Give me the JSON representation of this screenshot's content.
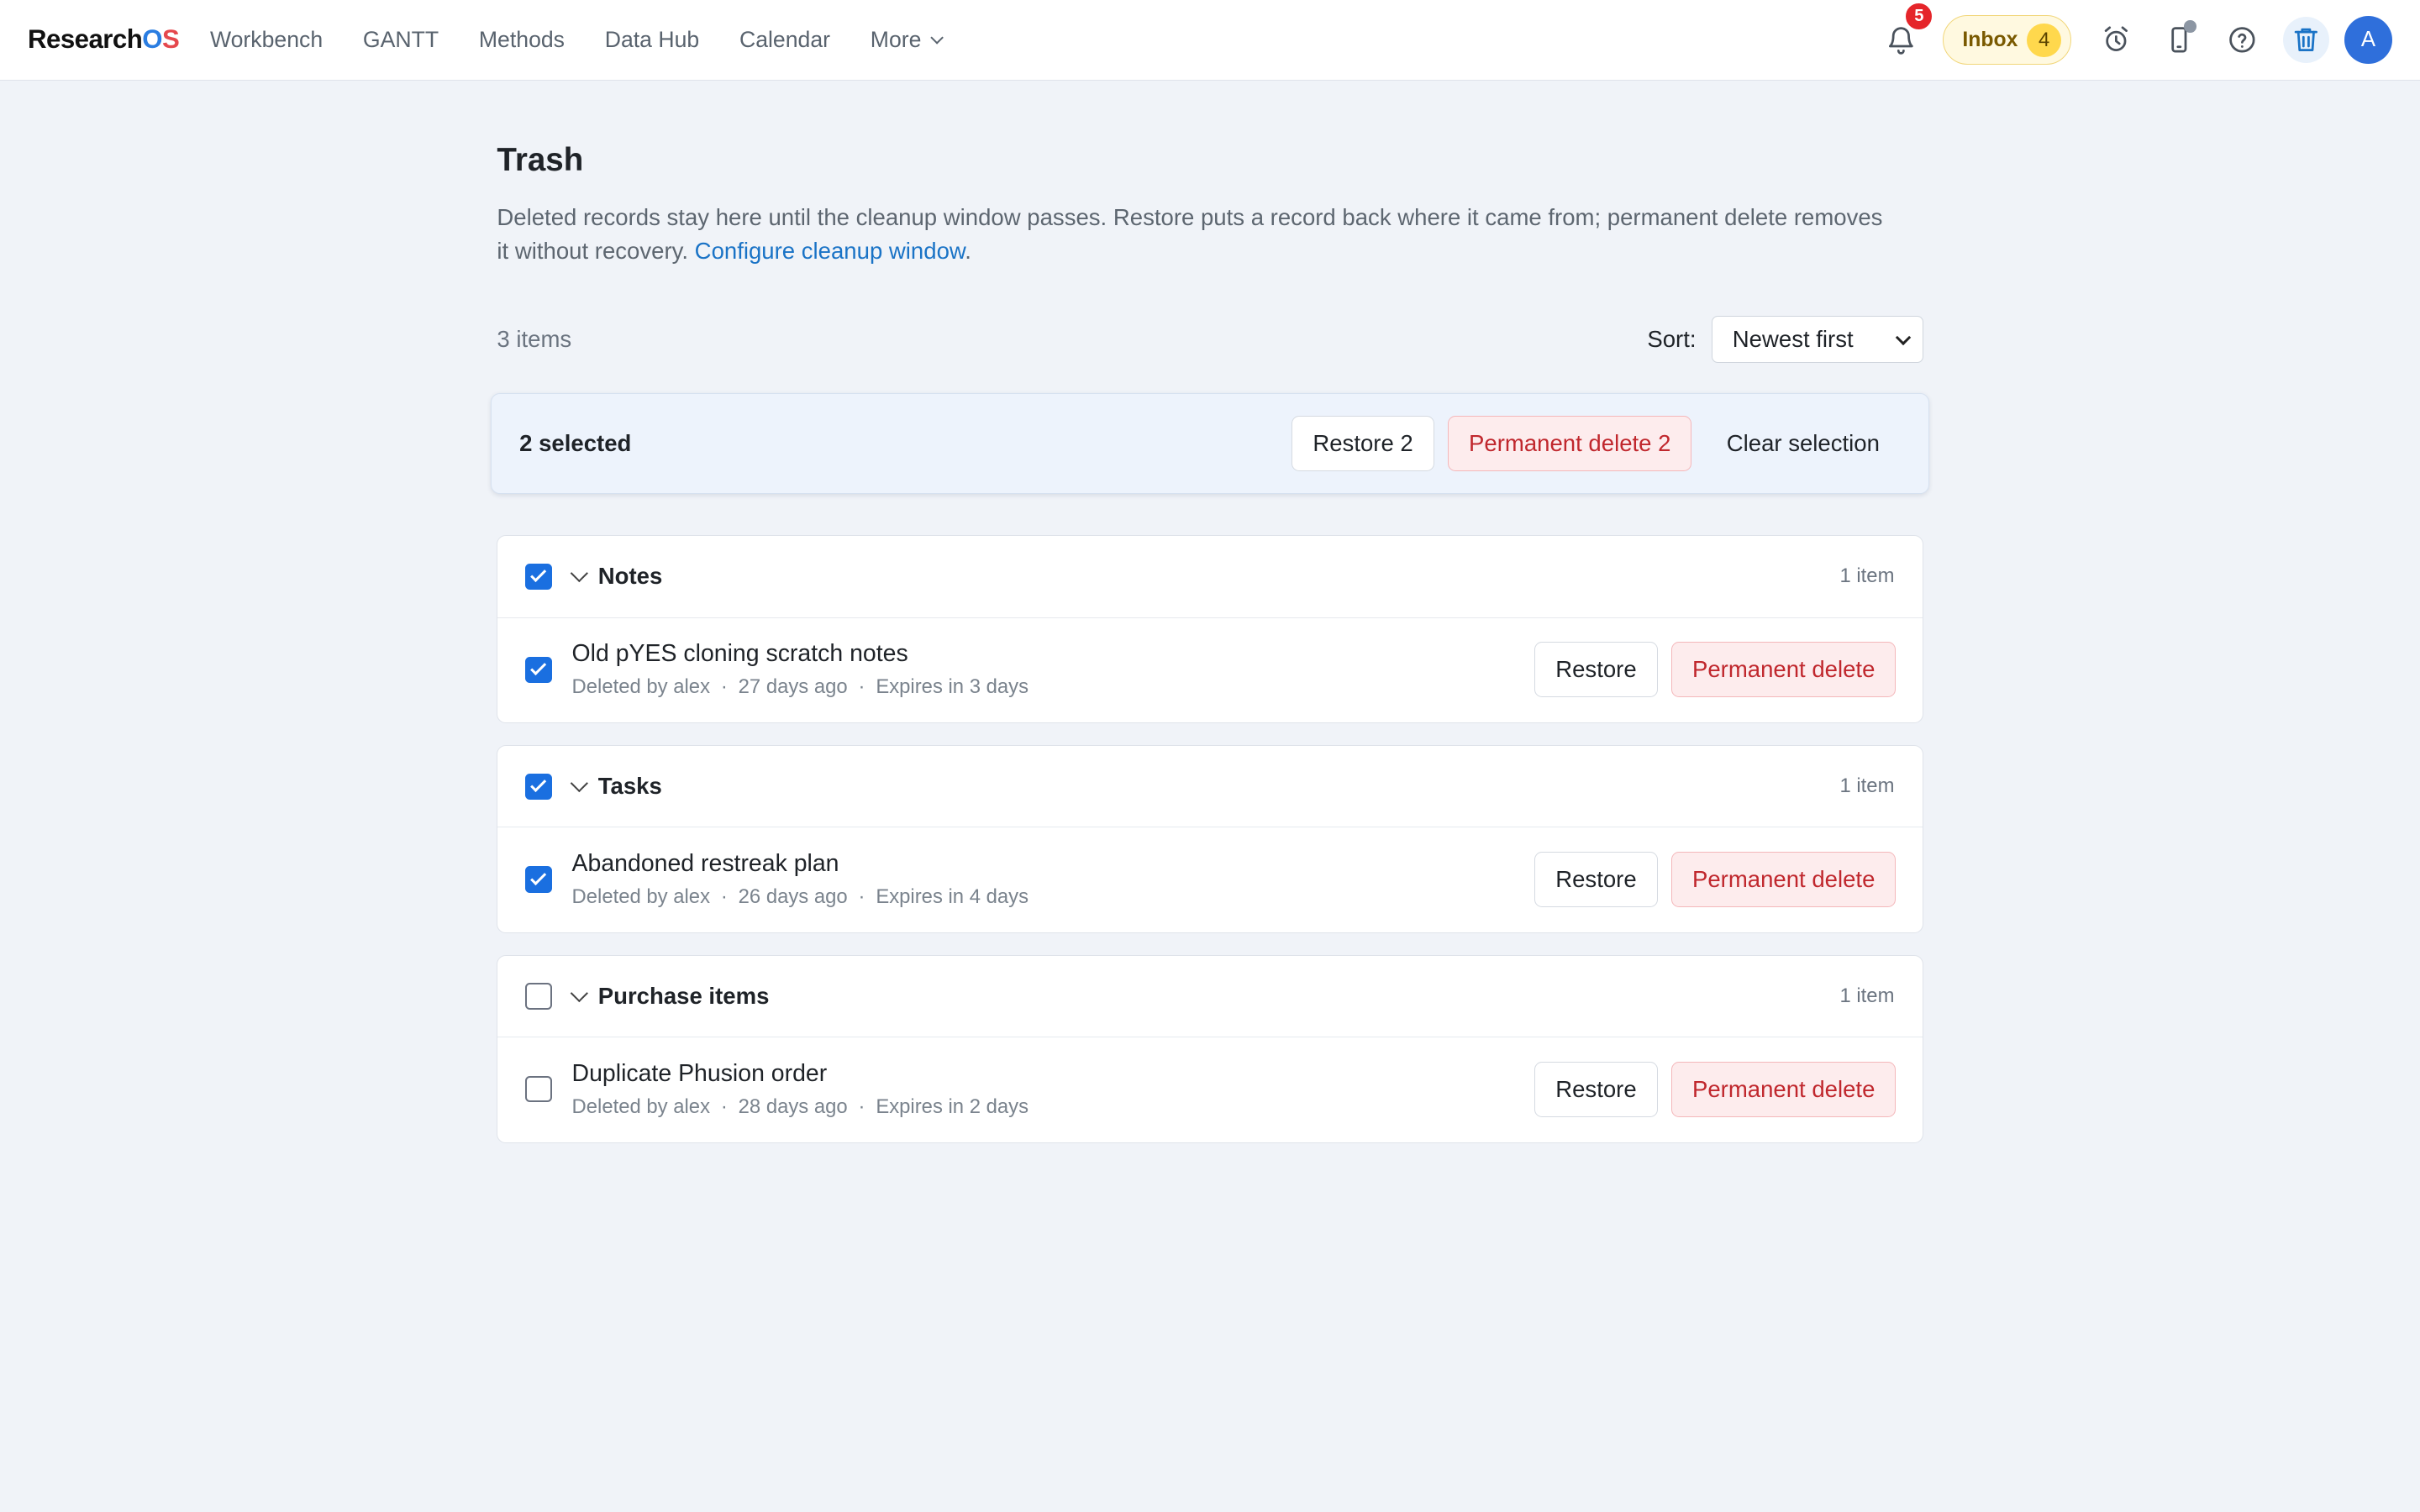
{
  "brand": {
    "name_part1": "Research",
    "name_o": "O",
    "name_s": "S"
  },
  "nav": {
    "items": [
      "Workbench",
      "GANTT",
      "Methods",
      "Data Hub",
      "Calendar"
    ],
    "more_label": "More"
  },
  "topbar": {
    "notification_count": "5",
    "inbox_label": "Inbox",
    "inbox_count": "4",
    "avatar_initial": "A"
  },
  "page": {
    "title": "Trash",
    "description": "Deleted records stay here until the cleanup window passes. Restore puts a record back where it came from; permanent delete removes it without recovery.",
    "config_link": "Configure cleanup window",
    "item_count": "3 items",
    "sort_label": "Sort:",
    "sort_value": "Newest first"
  },
  "bulk": {
    "selected_label": "2 selected",
    "restore_label": "Restore 2",
    "delete_label": "Permanent delete 2",
    "clear_label": "Clear selection"
  },
  "groups": [
    {
      "title": "Notes",
      "count": "1 item",
      "checked": true,
      "item": {
        "title": "Old pYES cloning scratch notes",
        "deleted_by": "Deleted by alex",
        "age": "27 days ago",
        "expires": "Expires in 3 days",
        "checked": true
      }
    },
    {
      "title": "Tasks",
      "count": "1 item",
      "checked": true,
      "item": {
        "title": "Abandoned restreak plan",
        "deleted_by": "Deleted by alex",
        "age": "26 days ago",
        "expires": "Expires in 4 days",
        "checked": true
      }
    },
    {
      "title": "Purchase items",
      "count": "1 item",
      "checked": false,
      "item": {
        "title": "Duplicate Phusion order",
        "deleted_by": "Deleted by alex",
        "age": "28 days ago",
        "expires": "Expires in 2 days",
        "checked": false
      }
    }
  ],
  "row_actions": {
    "restore_label": "Restore",
    "delete_label": "Permanent delete",
    "separator": "·"
  },
  "colors": {
    "accent": "#1a6fe0",
    "danger": "#c0272d",
    "danger_bg": "#fdeced",
    "page_bg": "#f0f3f8",
    "link": "#1a73c6"
  }
}
